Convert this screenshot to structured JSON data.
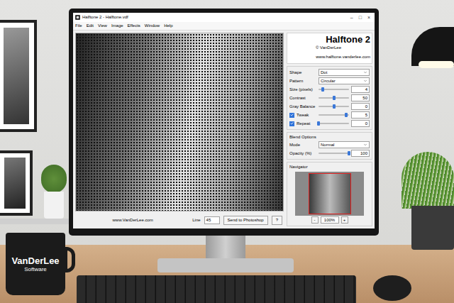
{
  "window": {
    "title": "Halftone 2 - Halftone.vdf",
    "controls": [
      "–",
      "□",
      "×"
    ]
  },
  "menu": [
    "File",
    "Edit",
    "View",
    "Image",
    "Effects",
    "Window",
    "Help"
  ],
  "panel": {
    "title": "Halftone 2",
    "copyright": "© VanDerLee",
    "url": "www.halftone.vanderlee.com"
  },
  "settings": [
    {
      "kind": "dropdown",
      "label": "Shape",
      "value": "Dot"
    },
    {
      "kind": "dropdown",
      "label": "Pattern",
      "value": "Circular"
    },
    {
      "kind": "slider",
      "label": "Size (pixels)",
      "value": "4",
      "level": 0.15
    },
    {
      "kind": "slider",
      "label": "Contrast",
      "value": "50",
      "level": 0.5
    },
    {
      "kind": "slider",
      "label": "Gray Balance",
      "value": "0",
      "level": 0.5
    },
    {
      "kind": "checkslider",
      "label": "Tweak",
      "checked": true,
      "value": "5",
      "level": 0.9
    },
    {
      "kind": "checkslider",
      "label": "Repeat",
      "checked": true,
      "value": "0",
      "level": 0.0
    }
  ],
  "blend": {
    "title": "Blend Options",
    "rows": [
      {
        "kind": "dropdown",
        "label": "Mode",
        "value": "Normal"
      },
      {
        "kind": "slider",
        "label": "Opacity (%)",
        "value": "100",
        "level": 1.0
      }
    ]
  },
  "navigator": {
    "title": "Navigator",
    "minus": "-",
    "zoom": "100%",
    "plus": "+"
  },
  "status": {
    "website": "www.VanDerLee.com",
    "line_label": "Line",
    "line_value": "45",
    "buttons": [
      "Send to Photoshop",
      "?"
    ]
  },
  "mug": {
    "brand": "VanDerLee",
    "subtitle": "Software"
  }
}
